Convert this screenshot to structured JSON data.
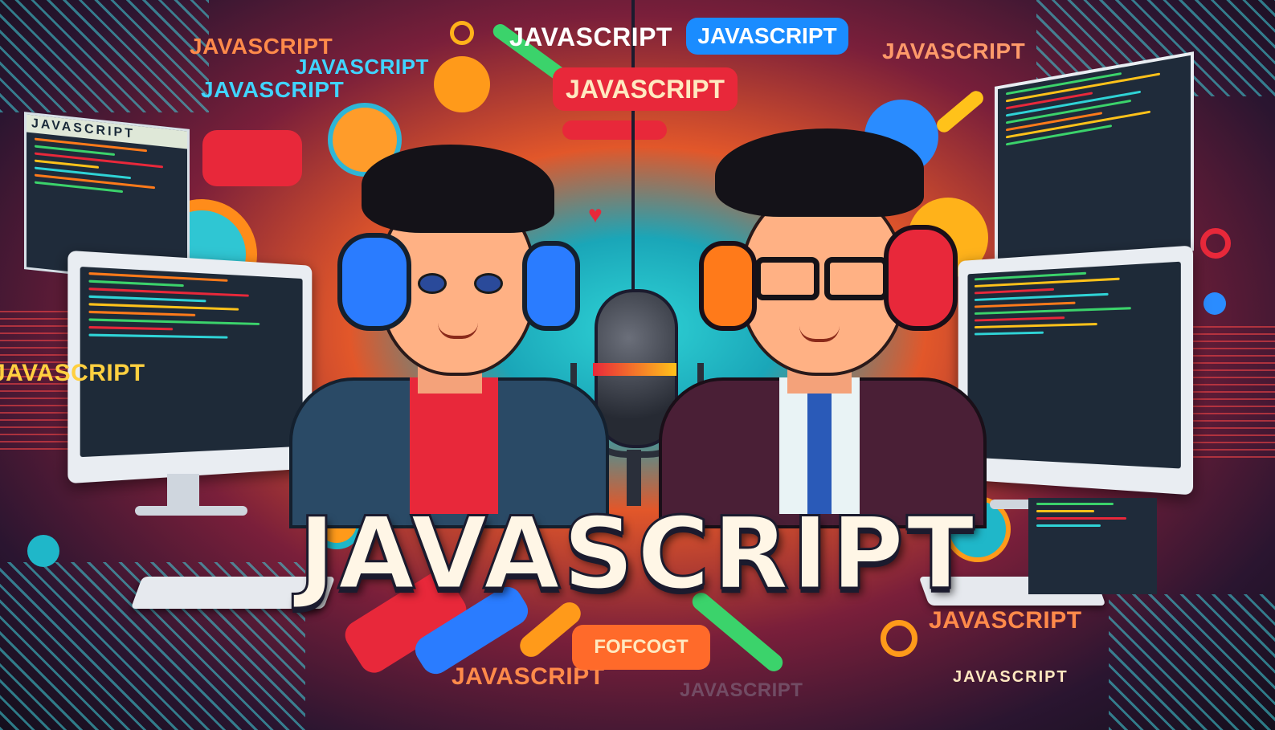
{
  "title": "JAVASCRIPT",
  "words": [
    {
      "key": "w1",
      "text": "JAVASCRIPT"
    },
    {
      "key": "w2",
      "text": "JAVASCRIPT"
    },
    {
      "key": "w3",
      "text": "JAVASCRIPT"
    },
    {
      "key": "w4",
      "text": "JAVASCRIPT"
    },
    {
      "key": "w5",
      "text": "JAVASCRIPT"
    },
    {
      "key": "w6",
      "text": "JAVASCRIPT"
    },
    {
      "key": "w7",
      "text": "JAVASCRIPT"
    },
    {
      "key": "w8",
      "text": "JAVASCRIPT"
    },
    {
      "key": "w9",
      "text": "JAVASCRIPT"
    },
    {
      "key": "w10",
      "text": "JAVASCRIPT"
    }
  ],
  "pills": {
    "blue": "JAVASCRIPT",
    "red": "JAVASCRIPT",
    "orange": "FOFCOGT"
  },
  "screen_words": {
    "left_panel": "JAVASCRIPT",
    "bottom_right": "JAVASCRIPT"
  },
  "colors": {
    "cyan": "#2fd3d6",
    "orange": "#ff7a1a",
    "red": "#e8283a",
    "blue": "#2a7cff",
    "green": "#3bd36b",
    "yellow": "#ffc21a"
  }
}
